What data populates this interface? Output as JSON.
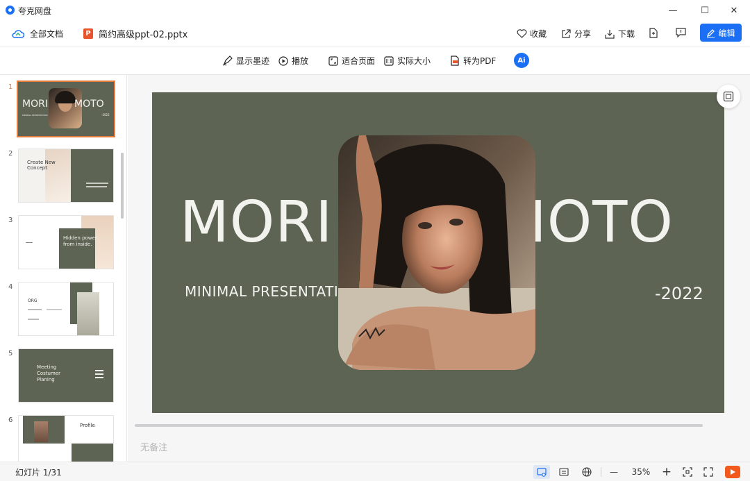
{
  "app": {
    "name": "夸克网盘",
    "accent": "#1a6ff5"
  },
  "window": {
    "minimize": "—",
    "maximize": "☐",
    "close": "✕"
  },
  "header": {
    "all_docs_label": "全部文档",
    "file_name": "简约高级ppt-02.pptx",
    "file_badge": "P",
    "favorite_label": "收藏",
    "share_label": "分享",
    "download_label": "下载",
    "edit_label": "编辑"
  },
  "viewer_toolbar": {
    "show_ink": "显示墨迹",
    "play": "播放",
    "fit_page": "适合页面",
    "actual_size": "实际大小",
    "to_pdf": "转为PDF",
    "ai_label": "Ai"
  },
  "thumbnails": [
    {
      "number": "1",
      "active": true,
      "left_text": "MORI",
      "right_text": "MOTO",
      "sub": "MINIMAL PRESENTATION",
      "year": "-2022"
    },
    {
      "number": "2",
      "title": "Create New Concept"
    },
    {
      "number": "3",
      "title": "Hidden power from inside."
    },
    {
      "number": "4",
      "title": "ORG"
    },
    {
      "number": "5",
      "title": "Meeting Costumer Planing"
    },
    {
      "number": "6",
      "title": "Profile"
    }
  ],
  "slide": {
    "left_title": "MORI",
    "right_title": "MOTO",
    "subtitle": "MINIMAL PRESENTATION",
    "year": "-2022",
    "bg_color": "#5e6454"
  },
  "notes_placeholder": "无备注",
  "status": {
    "slide_counter": "幻灯片 1/31",
    "zoom": "35%",
    "minus": "—",
    "plus": "+"
  }
}
